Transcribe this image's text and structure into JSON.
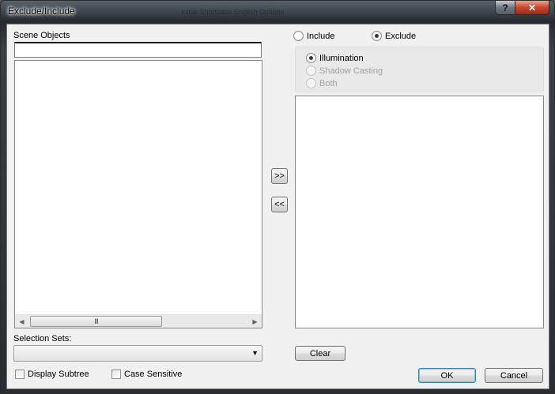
{
  "window": {
    "title": "Exclude/Include",
    "background_title": "Initial Shortbase English Options",
    "help_label": "?",
    "close_label": "✕"
  },
  "scene_objects": {
    "label": "Scene Objects",
    "filter_value": "",
    "items": [],
    "scroll_thumb_grip": "III"
  },
  "transfer": {
    "add_label": ">>",
    "remove_label": "<<"
  },
  "mode": {
    "include_label": "Include",
    "exclude_label": "Exclude",
    "selected": "exclude"
  },
  "type_options": {
    "illumination_label": "Illumination",
    "shadow_label": "Shadow Casting",
    "both_label": "Both",
    "selected": "illumination"
  },
  "excluded_items": [],
  "selection_sets": {
    "label": "Selection Sets:",
    "value": ""
  },
  "options": {
    "display_subtree_label": "Display Subtree",
    "case_sensitive_label": "Case Sensitive"
  },
  "buttons": {
    "clear_label": "Clear",
    "ok_label": "OK",
    "cancel_label": "Cancel"
  },
  "colors": {
    "titlebar": "#3e454c",
    "client": "#f0f0f0",
    "close": "#c7462b"
  }
}
